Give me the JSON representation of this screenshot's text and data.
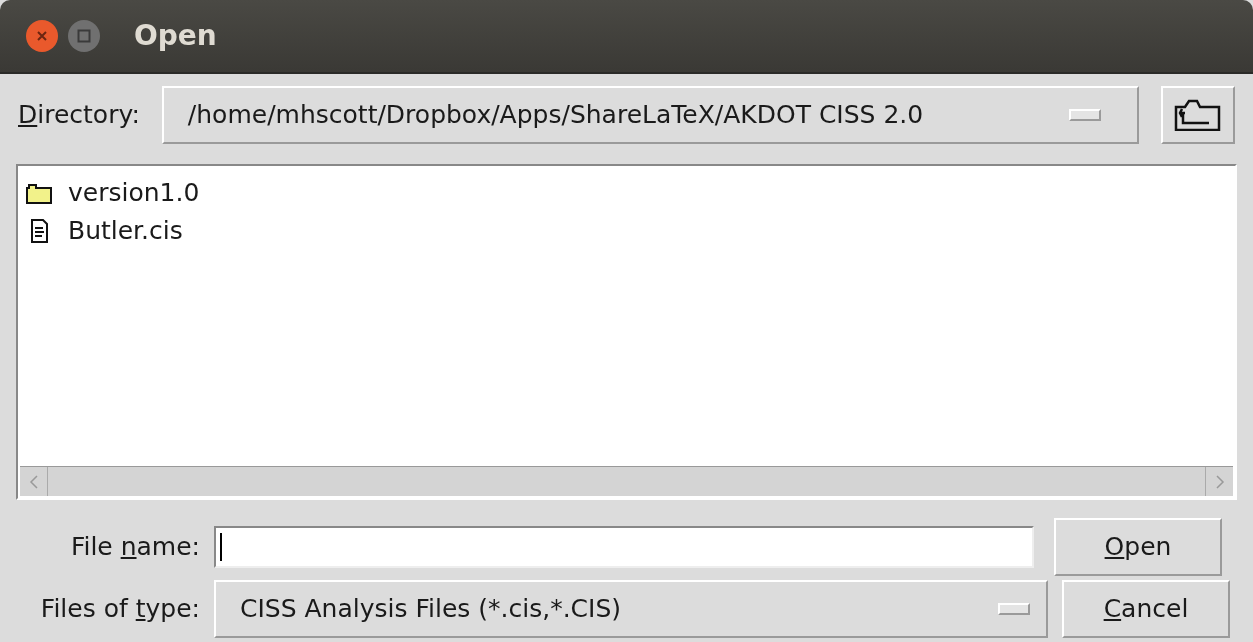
{
  "window": {
    "title": "Open"
  },
  "directory": {
    "label": {
      "key": "D",
      "after": "irectory:"
    },
    "value": "/home/mhscott/Dropbox/Apps/ShareLaTeX/AKDOT CISS 2.0"
  },
  "files": [
    {
      "name": "version1.0",
      "kind": "folder",
      "selected": false
    },
    {
      "name": "Butler.cis",
      "kind": "file",
      "selected": false
    }
  ],
  "file_name": {
    "label": {
      "before": "File ",
      "key": "n",
      "after": "ame:"
    }
  },
  "file_type": {
    "label": {
      "before": "Files of ",
      "key": "t",
      "after": "ype:"
    },
    "value": "CISS Analysis Files (*.cis,*.CIS)"
  },
  "buttons": [
    {
      "key": "O",
      "after": "pen"
    },
    {
      "key": "C",
      "after": "ancel"
    }
  ]
}
